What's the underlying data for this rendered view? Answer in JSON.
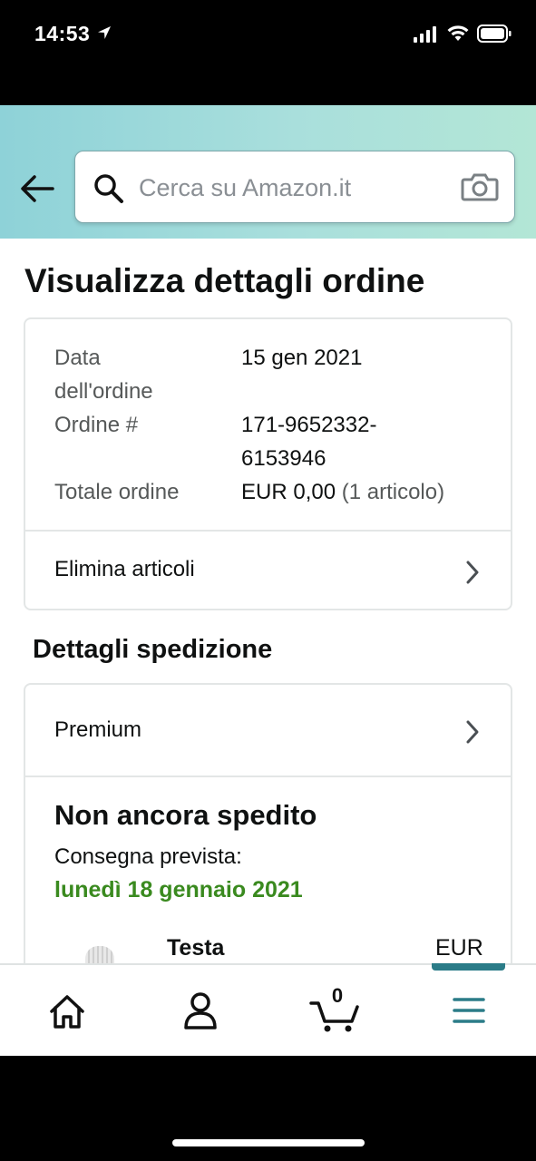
{
  "status_bar": {
    "time": "14:53"
  },
  "search": {
    "placeholder": "Cerca su Amazon.it"
  },
  "page": {
    "title": "Visualizza dettagli ordine"
  },
  "order_summary": {
    "date_label_line1": "Data",
    "date_label_line2": "dell'ordine",
    "date_value": "15 gen 2021",
    "order_label": "Ordine #",
    "order_number_line1": "171-9652332-",
    "order_number_line2": "6153946",
    "total_label": "Totale ordine",
    "total_value": "EUR 0,00",
    "total_items": "(1 articolo)",
    "delete_items_label": "Elimina articoli"
  },
  "shipping": {
    "section_title": "Dettagli spedizione",
    "method_label": "Premium",
    "status": "Non ancora spedito",
    "delivery_label": "Consegna prevista:",
    "delivery_date": "lunedì 18 gennaio 2021",
    "delivery_color": "#3a8a1f",
    "product_name": "Testa",
    "product_price": "EUR"
  },
  "bottom_nav": {
    "items": [
      "home-icon",
      "account-icon",
      "cart-icon",
      "menu-icon"
    ],
    "cart_count": "0",
    "active_color": "#2b7c88"
  }
}
